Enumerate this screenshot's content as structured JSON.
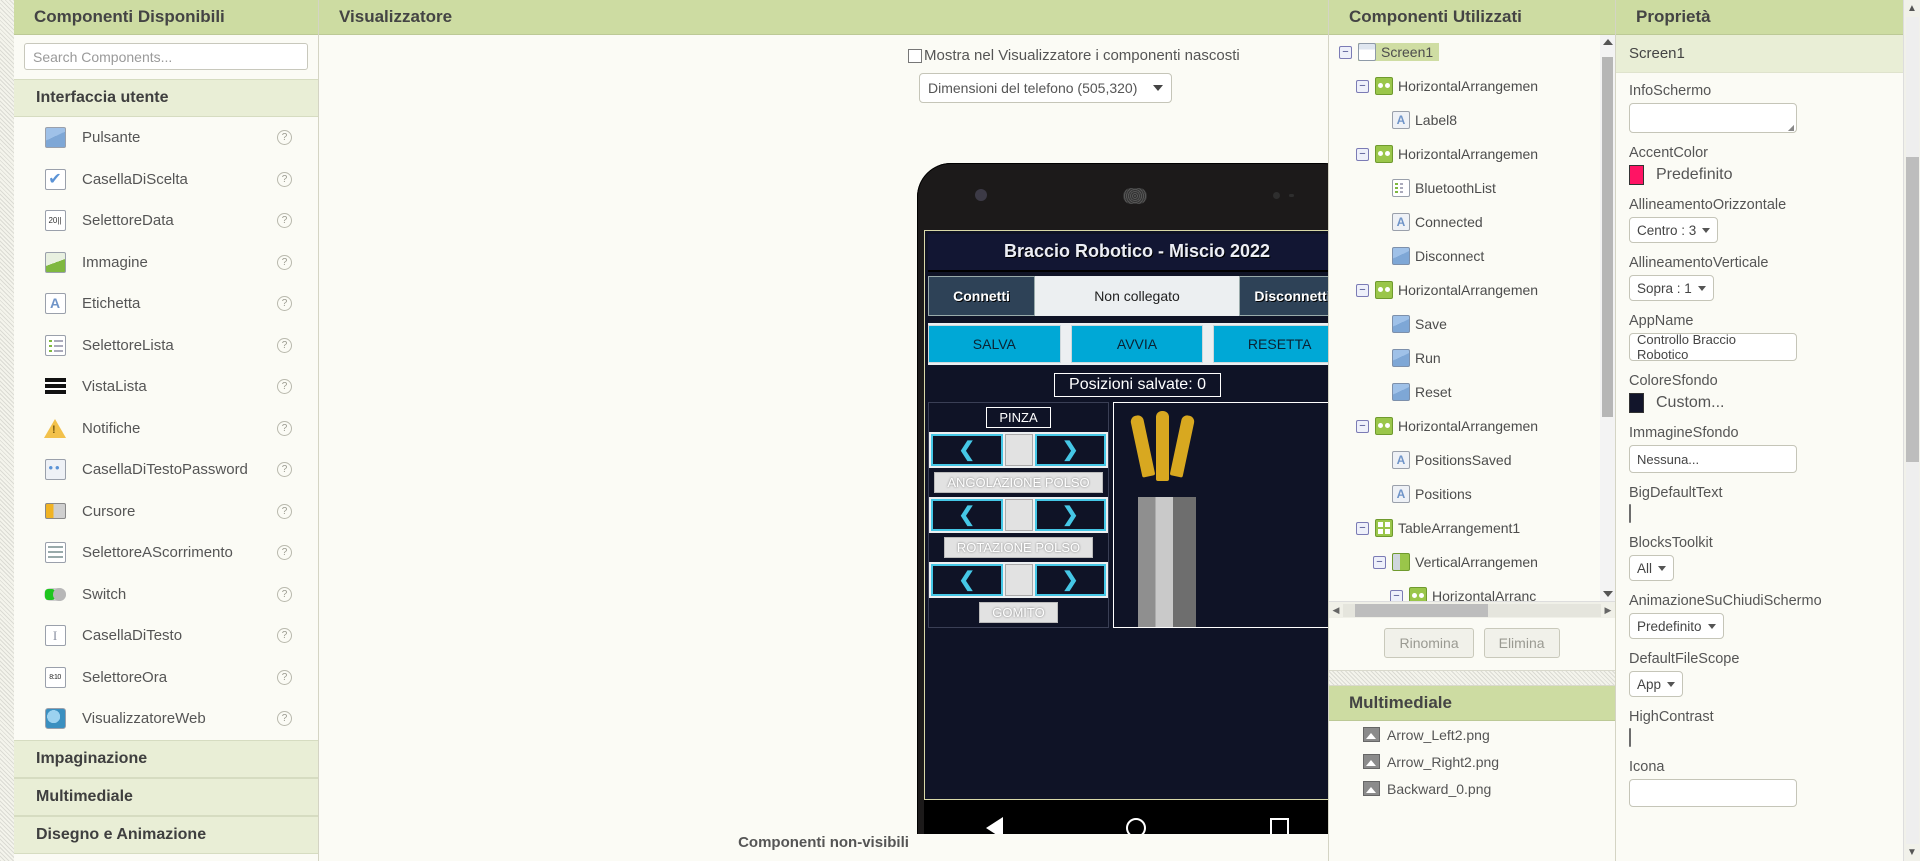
{
  "palette": {
    "header": "Componenti Disponibili",
    "search_placeholder": "Search Components...",
    "categories": [
      {
        "label": "Interfaccia utente",
        "open": true
      },
      {
        "label": "Impaginazione",
        "open": false
      },
      {
        "label": "Multimediale",
        "open": false
      },
      {
        "label": "Disegno e Animazione",
        "open": false
      }
    ],
    "components": [
      {
        "label": "Pulsante",
        "icon": "button-icon",
        "help": "?"
      },
      {
        "label": "CasellaDiScelta",
        "icon": "checkbox-icon",
        "help": "?"
      },
      {
        "label": "SelettoreData",
        "icon": "datepicker-icon",
        "help": "?"
      },
      {
        "label": "Immagine",
        "icon": "image-icon",
        "help": "?"
      },
      {
        "label": "Etichetta",
        "icon": "label-icon",
        "help": "?"
      },
      {
        "label": "SelettoreLista",
        "icon": "listpicker-icon",
        "help": "?"
      },
      {
        "label": "VistaLista",
        "icon": "listview-icon",
        "help": "?"
      },
      {
        "label": "Notifiche",
        "icon": "notifier-icon",
        "help": "?"
      },
      {
        "label": "CasellaDiTestoPassword",
        "icon": "password-textbox-icon",
        "help": "?"
      },
      {
        "label": "Cursore",
        "icon": "slider-icon",
        "help": "?"
      },
      {
        "label": "SelettoreAScorrimento",
        "icon": "spinner-icon",
        "help": "?"
      },
      {
        "label": "Switch",
        "icon": "switch-icon",
        "help": "?"
      },
      {
        "label": "CasellaDiTesto",
        "icon": "textbox-icon",
        "help": "?"
      },
      {
        "label": "SelettoreOra",
        "icon": "timepicker-icon",
        "help": "?"
      },
      {
        "label": "VisualizzatoreWeb",
        "icon": "webviewer-icon",
        "help": "?"
      }
    ]
  },
  "viewer": {
    "header": "Visualizzatore",
    "show_hidden_label": "Mostra nel Visualizzatore i componenti nascosti",
    "size_select_value": "Dimensioni del telefono (505,320)",
    "footer": "Componenti non-visibili",
    "phone": {
      "app_title": "Braccio Robotico - Miscio 2022",
      "connect_button": "Connetti",
      "status_label": "Non collegato",
      "disconnect_button": "Disconnetti",
      "save_button": "SALVA",
      "run_button": "AVVIA",
      "reset_button": "RESETTA",
      "positions_label": "Posizioni salvate:   0",
      "controls": [
        {
          "caption": "PINZA",
          "style": "dark",
          "left_arrow": "❮",
          "right_arrow": "❯"
        },
        {
          "caption": "ANGOLAZIONE POLSO",
          "style": "grey",
          "left_arrow": "❮",
          "right_arrow": "❯"
        },
        {
          "caption": "ROTAZIONE POLSO",
          "style": "grey",
          "left_arrow": "❮",
          "right_arrow": "❯"
        },
        {
          "caption": "GOMITO",
          "style": "grey",
          "left_arrow": "❮",
          "right_arrow": "❯"
        }
      ],
      "nav": {
        "back": "back-icon",
        "home": "home-icon",
        "recents": "recents-icon"
      }
    }
  },
  "tree": {
    "header": "Componenti Utilizzati",
    "nodes": [
      {
        "label": "Screen1",
        "depth": 0,
        "icon": "screen",
        "toggle": "−",
        "selected": true
      },
      {
        "label": "HorizontalArrangemen",
        "depth": 1,
        "icon": "harr",
        "toggle": "−",
        "selected": false
      },
      {
        "label": "Label8",
        "depth": 2,
        "icon": "label",
        "toggle": "",
        "selected": false
      },
      {
        "label": "HorizontalArrangemen",
        "depth": 1,
        "icon": "harr",
        "toggle": "−",
        "selected": false
      },
      {
        "label": "BluetoothList",
        "depth": 2,
        "icon": "lst",
        "toggle": "",
        "selected": false
      },
      {
        "label": "Connected",
        "depth": 2,
        "icon": "label",
        "toggle": "",
        "selected": false
      },
      {
        "label": "Disconnect",
        "depth": 2,
        "icon": "btn",
        "toggle": "",
        "selected": false
      },
      {
        "label": "HorizontalArrangemen",
        "depth": 1,
        "icon": "harr",
        "toggle": "−",
        "selected": false
      },
      {
        "label": "Save",
        "depth": 2,
        "icon": "btn",
        "toggle": "",
        "selected": false
      },
      {
        "label": "Run",
        "depth": 2,
        "icon": "btn",
        "toggle": "",
        "selected": false
      },
      {
        "label": "Reset",
        "depth": 2,
        "icon": "btn",
        "toggle": "",
        "selected": false
      },
      {
        "label": "HorizontalArrangemen",
        "depth": 1,
        "icon": "harr",
        "toggle": "−",
        "selected": false
      },
      {
        "label": "PositionsSaved",
        "depth": 2,
        "icon": "label",
        "toggle": "",
        "selected": false
      },
      {
        "label": "Positions",
        "depth": 2,
        "icon": "label",
        "toggle": "",
        "selected": false
      },
      {
        "label": "TableArrangement1",
        "depth": 1,
        "icon": "tarr",
        "toggle": "−",
        "selected": false
      },
      {
        "label": "VerticalArrangemen",
        "depth": 2,
        "icon": "varr",
        "toggle": "−",
        "selected": false
      },
      {
        "label": "HorizontalArranc",
        "depth": 3,
        "icon": "harr",
        "toggle": "−",
        "selected": false
      }
    ],
    "rename_button": "Rinomina",
    "delete_button": "Elimina"
  },
  "media": {
    "header": "Multimediale",
    "files": [
      {
        "name": "Arrow_Left2.png"
      },
      {
        "name": "Arrow_Right2.png"
      },
      {
        "name": "Backward_0.png"
      }
    ]
  },
  "properties": {
    "header": "Proprietà",
    "subject": "Screen1",
    "items": [
      {
        "label": "InfoSchermo",
        "kind": "textarea",
        "value": ""
      },
      {
        "label": "AccentColor",
        "kind": "color",
        "value": "Predefinito",
        "swatch": "#ff1464"
      },
      {
        "label": "AllineamentoOrizzontale",
        "kind": "select",
        "value": "Centro : 3"
      },
      {
        "label": "AllineamentoVerticale",
        "kind": "select",
        "value": "Sopra : 1"
      },
      {
        "label": "AppName",
        "kind": "text",
        "value": "Controllo Braccio Robotico"
      },
      {
        "label": "ColoreSfondo",
        "kind": "color",
        "value": "Custom...",
        "swatch": "#12152b"
      },
      {
        "label": "ImmagineSfondo",
        "kind": "text",
        "value": "Nessuna..."
      },
      {
        "label": "BigDefaultText",
        "kind": "checkbox",
        "value": ""
      },
      {
        "label": "BlocksToolkit",
        "kind": "select",
        "value": "All"
      },
      {
        "label": "AnimazioneSuChiudiSchermo",
        "kind": "select",
        "value": "Predefinito"
      },
      {
        "label": "DefaultFileScope",
        "kind": "select",
        "value": "App"
      },
      {
        "label": "HighContrast",
        "kind": "checkbox",
        "value": ""
      },
      {
        "label": "Icona",
        "kind": "text",
        "value": ""
      }
    ]
  },
  "colors": {
    "panel_header_bg": "#cddca2",
    "accent_pink": "#ff1464",
    "phone_bg": "#0f1326",
    "cyan_button": "#00a8d6",
    "dark_button": "#2e4257"
  }
}
